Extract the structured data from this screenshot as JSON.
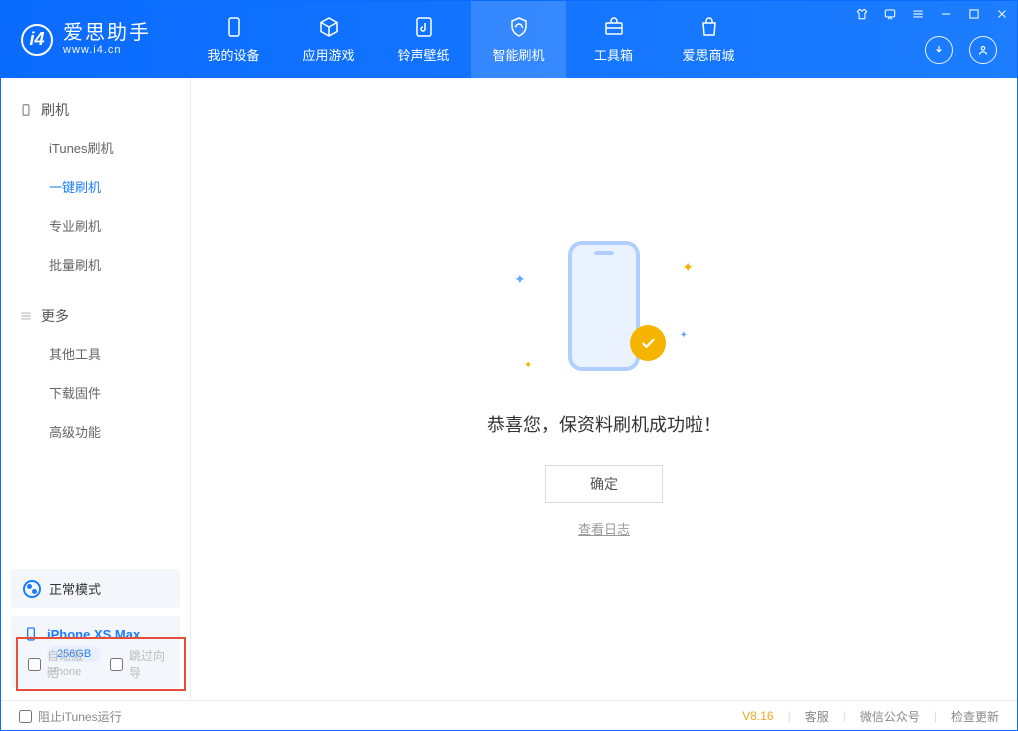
{
  "header": {
    "logo_title": "爱思助手",
    "logo_url": "www.i4.cn",
    "tabs": [
      {
        "label": "我的设备"
      },
      {
        "label": "应用游戏"
      },
      {
        "label": "铃声壁纸"
      },
      {
        "label": "智能刷机"
      },
      {
        "label": "工具箱"
      },
      {
        "label": "爱思商城"
      }
    ]
  },
  "sidebar": {
    "group1_title": "刷机",
    "group1_items": [
      "iTunes刷机",
      "一键刷机",
      "专业刷机",
      "批量刷机"
    ],
    "group2_title": "更多",
    "group2_items": [
      "其他工具",
      "下载固件",
      "高级功能"
    ]
  },
  "device": {
    "mode": "正常模式",
    "name": "iPhone XS Max",
    "storage": "256GB",
    "type": "iPhone"
  },
  "main": {
    "success_message": "恭喜您，保资料刷机成功啦！",
    "ok_button": "确定",
    "log_link": "查看日志"
  },
  "options": {
    "auto_activate": "自动激活",
    "skip_guide": "跳过向导"
  },
  "footer": {
    "block_itunes": "阻止iTunes运行",
    "version": "V8.16",
    "support": "客服",
    "wechat": "微信公众号",
    "check_update": "检查更新"
  }
}
